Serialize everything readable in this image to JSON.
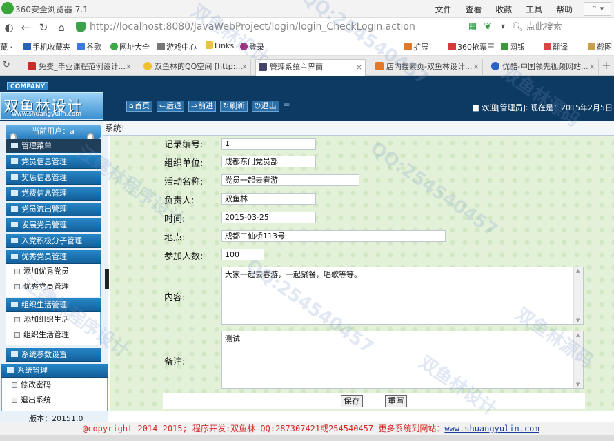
{
  "browser": {
    "title": "360安全浏览器 7.1",
    "menus": [
      "文件",
      "查看",
      "收藏",
      "工具",
      "帮助"
    ],
    "url_host": "http://localhost",
    "url_rest": ":8080/JavaWebProject/login/login_CheckLogin.action",
    "search_placeholder": "点此搜索",
    "favorites": [
      "藏 ·",
      "手机收藏夹",
      "谷歌",
      "网址大全",
      "游戏中心",
      "Links",
      "登录",
      "扩展",
      "360抢票王",
      "网银",
      "翻译",
      "截图"
    ],
    "tabs": [
      {
        "label": "免费_毕业课程范例设计..."
      },
      {
        "label": "双鱼林的QQ空间 [http:..."
      },
      {
        "label": "管理系统主界面"
      },
      {
        "label": "店内搜索页-双鱼林设计..."
      },
      {
        "label": "优酷-中国领先视频网站..."
      }
    ]
  },
  "app": {
    "company": "COMPANY",
    "brand_cn": "双鱼林设计",
    "brand_en": "www.shuangyulin.com",
    "toolbar": [
      {
        "icon": "home-icon",
        "glyph": "⌂",
        "label": "首页"
      },
      {
        "icon": "back-icon",
        "glyph": "⇐",
        "label": "后退"
      },
      {
        "icon": "forward-icon",
        "glyph": "⇒",
        "label": "前进"
      },
      {
        "icon": "refresh-icon",
        "glyph": "↻",
        "label": "刷新"
      },
      {
        "icon": "power-icon",
        "glyph": "⏻",
        "label": "退出"
      }
    ],
    "welcome": "■ 欢迎[管理员]:  现在是：2015年2月5日",
    "current_user": "当前用户：a",
    "menu_title": "管理菜单",
    "menu": [
      "党员信息管理",
      "奖惩信息管理",
      "党费信息管理",
      "党员流出管理",
      "发展党员管理",
      "入党积极分子管理",
      "优秀党员管理"
    ],
    "menu_excellent_sub": [
      "添加优秀党员",
      "优秀党员管理"
    ],
    "menu_org": "组织生活管理",
    "menu_org_sub": [
      "添加组织生活",
      "组织生活管理"
    ],
    "menu_params": "系统参数设置",
    "menu_sys": "系统管理",
    "menu_sys_sub": [
      "修改密码",
      "退出系统"
    ],
    "version": "版本：20151.0",
    "content_title": "系统!"
  },
  "form": {
    "record_no": {
      "label": "记录编号:",
      "value": "1"
    },
    "org_unit": {
      "label": "组织单位:",
      "value": "成都东门党员部"
    },
    "activity": {
      "label": "活动名称:",
      "value": "党员一起去春游"
    },
    "leader": {
      "label": "负责人:",
      "value": "双鱼林"
    },
    "time": {
      "label": "时间:",
      "value": "2015-03-25"
    },
    "place": {
      "label": "地点:",
      "value": "成都二仙桥113号"
    },
    "participants": {
      "label": "参加人数:",
      "value": "100"
    },
    "content": {
      "label": "内容:",
      "value": "大家一起去春游，一起聚餐，唱歌等等。"
    },
    "remark": {
      "label": "备注:",
      "value": "测试"
    },
    "save_label": "保存",
    "reset_label": "重写"
  },
  "footer": {
    "text": "@copyright 2014-2015; 程序开发:双鱼林  QQ:287307421或254540457  更多系统到网站：",
    "link": "www.shuangyulin.com"
  },
  "watermarks": [
    "双鱼林设计",
    "QQ:254540457",
    "双鱼林源码",
    "江建林程序设计",
    "QQ:254540457",
    "双鱼林源码",
    "江建林程序设计",
    "QQ:254540457",
    "双鱼林设计"
  ]
}
